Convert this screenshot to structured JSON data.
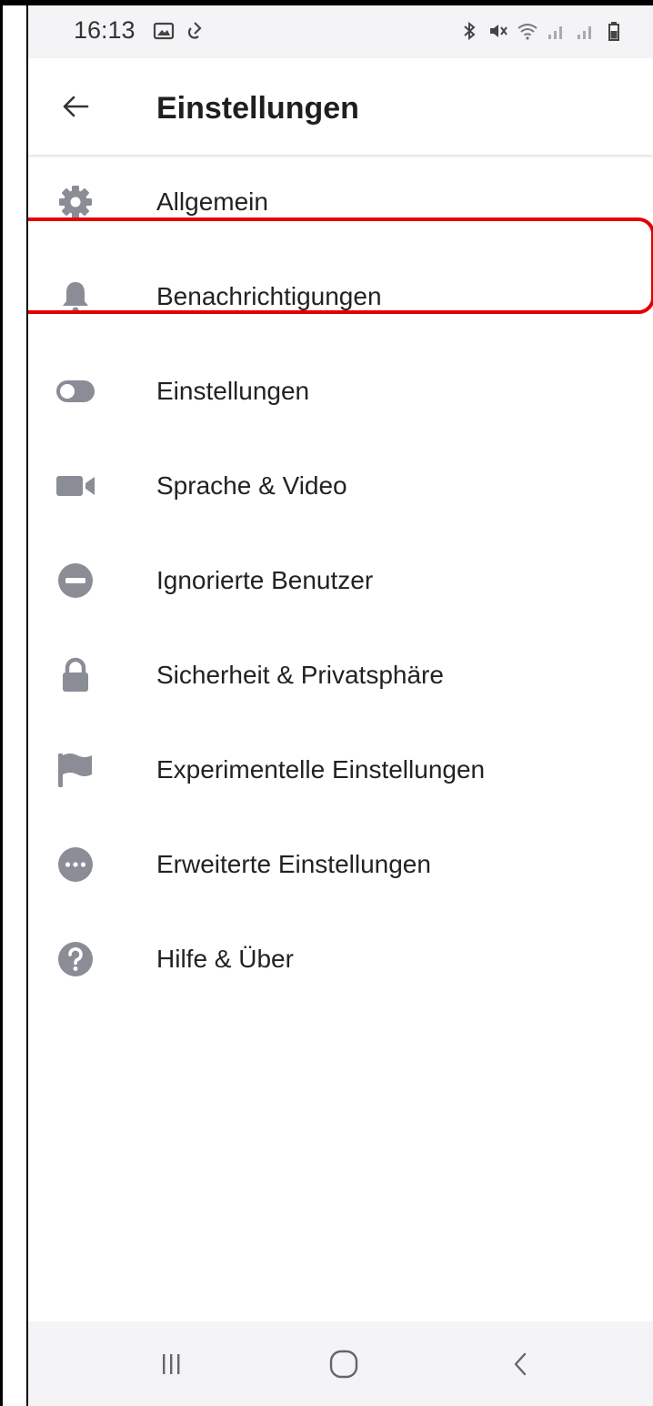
{
  "status_bar": {
    "time": "16:13",
    "left_icons": [
      "gallery-icon",
      "sync-icon"
    ],
    "right_icons": [
      "bluetooth-icon",
      "mute-icon",
      "wifi-icon",
      "signal-icon",
      "signal-icon",
      "battery-icon"
    ]
  },
  "appbar": {
    "back_icon": "arrow-left-icon",
    "title": "Einstellungen"
  },
  "menu": {
    "items": [
      {
        "label": "Allgemein",
        "icon": "gear-icon"
      },
      {
        "label": "Benachrichtigungen",
        "icon": "bell-icon"
      },
      {
        "label": "Einstellungen",
        "icon": "toggle-icon"
      },
      {
        "label": "Sprache & Video",
        "icon": "video-icon"
      },
      {
        "label": "Ignorierte Benutzer",
        "icon": "block-icon"
      },
      {
        "label": "Sicherheit & Privatsphäre",
        "icon": "lock-icon"
      },
      {
        "label": "Experimentelle Einstellungen",
        "icon": "flag-icon"
      },
      {
        "label": "Erweiterte Einstellungen",
        "icon": "more-icon"
      },
      {
        "label": "Hilfe & Über",
        "icon": "help-icon"
      }
    ]
  },
  "navbar": {
    "buttons": [
      "recent-apps-icon",
      "home-icon",
      "back-icon"
    ]
  },
  "colors": {
    "icon": "#8a8d96",
    "highlight": "#e30000",
    "bar_bg": "#f4f4f7"
  }
}
